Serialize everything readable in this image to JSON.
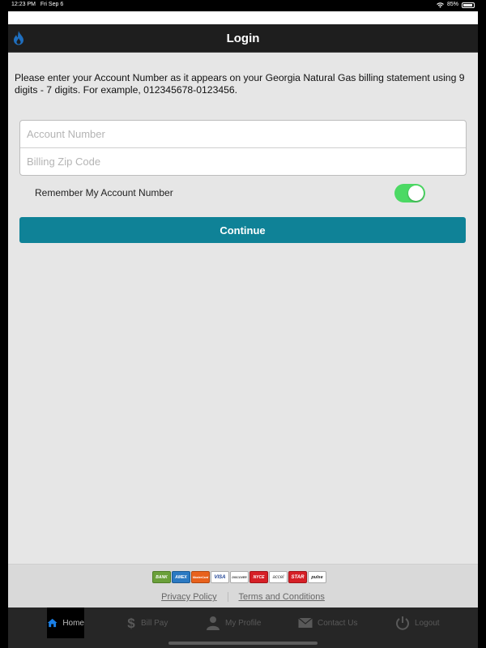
{
  "status": {
    "time": "12:23 PM",
    "date": "Fri Sep 6",
    "battery": "85%"
  },
  "nav": {
    "title": "Login"
  },
  "instructions": "Please enter your Account Number as it appears on your Georgia Natural Gas billing statement using 9 digits - 7 digits. For example, 012345678-0123456.",
  "form": {
    "account_placeholder": "Account Number",
    "account_value": "",
    "zip_placeholder": "Billing Zip Code",
    "zip_value": "",
    "remember_label": "Remember My Account Number",
    "remember_on": true,
    "continue_label": "Continue"
  },
  "payment_cards": [
    "BANK",
    "AMEX",
    "MasterCard",
    "VISA",
    "DISCOVER",
    "NYCE",
    "accel",
    "STAR",
    "pulse"
  ],
  "footer_links": {
    "privacy": "Privacy Policy",
    "terms": "Terms and Conditions"
  },
  "tabs": [
    {
      "label": "Home",
      "icon": "home-icon",
      "active": true
    },
    {
      "label": "Bill Pay",
      "icon": "dollar-icon",
      "active": false
    },
    {
      "label": "My Profile",
      "icon": "user-icon",
      "active": false
    },
    {
      "label": "Contact Us",
      "icon": "envelope-icon",
      "active": false
    },
    {
      "label": "Logout",
      "icon": "power-icon",
      "active": false
    }
  ],
  "colors": {
    "accent": "#0f8297",
    "toggle_on": "#4cd964",
    "active_tab_icon": "#1a7fe6"
  }
}
